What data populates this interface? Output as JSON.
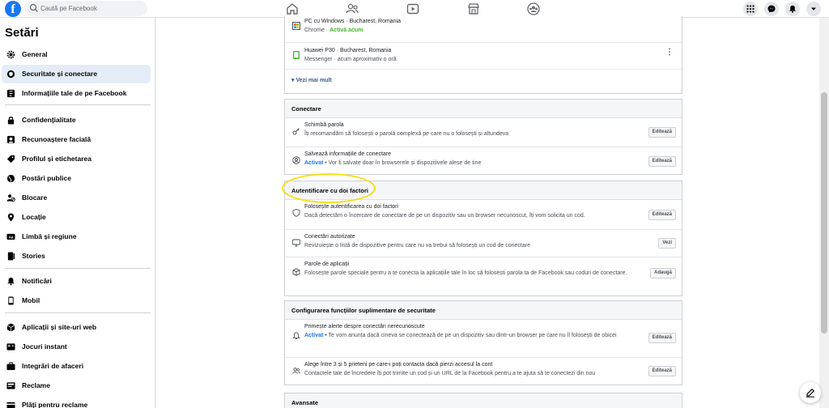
{
  "topbar": {
    "logo": "f",
    "search_placeholder": "Caută pe Facebook",
    "nav_icons": [
      "home-icon",
      "friends-icon",
      "watch-icon",
      "marketplace-icon",
      "groups-icon"
    ],
    "right_icons": [
      "menu-grid-icon",
      "messenger-icon",
      "notifications-icon",
      "account-chevron-icon"
    ]
  },
  "sidebar": {
    "title": "Setări",
    "items": [
      {
        "label": "General",
        "icon": "gear-icon"
      },
      {
        "label": "Securitate și conectare",
        "icon": "shield-icon",
        "active": true
      },
      {
        "label": "Informațiile tale de pe Facebook",
        "icon": "facebook-info-icon"
      },
      {
        "label": "Confidențialitate",
        "icon": "lock-icon"
      },
      {
        "label": "Recunoaștere facială",
        "icon": "face-icon"
      },
      {
        "label": "Profilul și etichetarea",
        "icon": "tag-icon"
      },
      {
        "label": "Postări publice",
        "icon": "globe-icon"
      },
      {
        "label": "Blocare",
        "icon": "block-user-icon"
      },
      {
        "label": "Locație",
        "icon": "location-pin-icon"
      },
      {
        "label": "Limbă și regiune",
        "icon": "language-icon"
      },
      {
        "label": "Stories",
        "icon": "stories-icon"
      },
      {
        "label": "Notificări",
        "icon": "bell-icon"
      },
      {
        "label": "Mobil",
        "icon": "mobile-icon"
      },
      {
        "label": "Aplicații și site-uri web",
        "icon": "apps-icon"
      },
      {
        "label": "Jocuri instant",
        "icon": "games-icon"
      },
      {
        "label": "Integrări de afaceri",
        "icon": "business-icon"
      },
      {
        "label": "Reclame",
        "icon": "ads-icon"
      },
      {
        "label": "Plăți pentru reclame",
        "icon": "payment-icon"
      }
    ]
  },
  "sessions": {
    "items": [
      {
        "device": "PC cu Windows · Bucharest, Romania",
        "app": "Chrome · ",
        "status": "Activă acum"
      },
      {
        "device": "Huawei P30 · Bucharest, Romania",
        "app": "Messenger · acum aproximativ o oră",
        "status": ""
      }
    ],
    "more": "Vezi mai mult"
  },
  "login": {
    "title": "Conectare",
    "rows": [
      {
        "title": "Schimbă parola",
        "desc": "Îți recomandăm să folosești o parolă complexă pe care nu o folosești și altundeva",
        "button": "Editează"
      },
      {
        "title": "Salvează informațiile de conectare",
        "activated": "Activat",
        "desc": " • Vor fi salvate doar în browserele și dispozitivele alese de tine",
        "button": "Editează"
      }
    ]
  },
  "twofa": {
    "title": "Autentificare cu doi factori",
    "rows": [
      {
        "title": "Folosește autentificarea cu doi factori",
        "desc": "Dacă detectăm o încercare de conectare de pe un dispozitiv sau un browser necunoscut, îți vom solicita un cod.",
        "button": "Editează"
      },
      {
        "title": "Conectări autorizate",
        "desc": "Revizuiește o listă de dispozitive pentru care nu va trebui să folosești un cod de conectare",
        "button": "Vezi"
      },
      {
        "title": "Parole de aplicații",
        "desc": "Folosește parole speciale pentru a te conecta la aplicațiile tale în loc să folosești parola ta de Facebook sau coduri de conectare.",
        "button": "Adaugă"
      }
    ]
  },
  "extra": {
    "title": "Configurarea funcțiilor suplimentare de securitate",
    "rows": [
      {
        "title": "Primește alerte despre conectări nerecunoscute",
        "activated": "Activat",
        "desc": " • Te vom anunța dacă cineva se conectează de pe un dispozitiv sau dintr-un browser pe care nu îl folosești de obicei",
        "button": "Editează"
      },
      {
        "title": "Alege între 3 și 5 prieteni pe care-i poți contacta dacă pierzi accesul la cont",
        "desc": "Contactele tale de încredere îți pot trimite un cod și un URL de la Facebook pentru a te ajuta să te conectezi din nou",
        "button": "Editează"
      }
    ]
  },
  "advanced": {
    "title": "Avansate"
  },
  "colors": {
    "brand": "#1877f2",
    "active_green": "#42b72a",
    "highlight": "#f5e11a"
  }
}
